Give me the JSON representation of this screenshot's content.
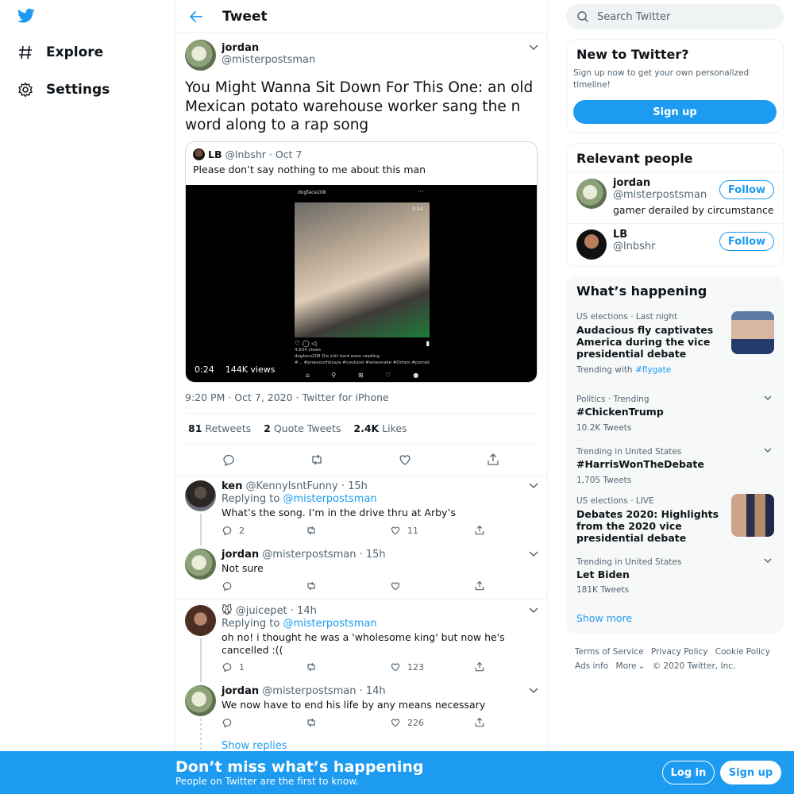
{
  "colors": {
    "accent": "#1d9bf0",
    "text": "#0f1419",
    "muted": "#536471",
    "border": "#eff3f4"
  },
  "nav": {
    "explore": "Explore",
    "settings": "Settings"
  },
  "header": {
    "title": "Tweet"
  },
  "tweet": {
    "name": "jordan",
    "handle": "@misterpostsman",
    "text": "You Might Wanna Sit Down For This One: an old Mexican potato warehouse worker sang the n word along to a rap song",
    "quote": {
      "name": "LB",
      "handle_date": "@lnbshr · Oct 7",
      "text": "Please don’t say nothing to me about this man",
      "video": {
        "account": "dogface208",
        "time_badge": "0:24",
        "views_line": "4,834 views",
        "caption": "dogface208 Dis shit hard even reading",
        "tags": "#... #pnwsouthbraza #couturel #wisesnake #Orfam #pioneba",
        "duration": "0:24",
        "views": "144K views"
      }
    },
    "meta": "9:20 PM · Oct 7, 2020 · Twitter for iPhone",
    "retweets_count": "81",
    "retweets_label": "Retweets",
    "quotes_count": "2",
    "quotes_label": "Quote Tweets",
    "likes_count": "2.4K",
    "likes_label": "Likes"
  },
  "replies": [
    {
      "name": "ken",
      "handle_time": "@KennyIsntFunny · 15h",
      "replying_prefix": "Replying to",
      "replying_to": "@misterpostsman",
      "text": "What’s the song. I’m in the drive thru at Arby’s",
      "replies": "2",
      "likes": "11"
    },
    {
      "name": "jordan",
      "handle_time": "@misterpostsman · 15h",
      "text": "Not sure"
    },
    {
      "name": "🐭",
      "handle_time": "@juicepet · 14h",
      "replying_prefix": "Replying to",
      "replying_to": "@misterpostsman",
      "text": "oh no! i thought he was a 'wholesome king' but now he's cancelled :((",
      "replies": "1",
      "likes": "123"
    },
    {
      "name": "jordan",
      "handle_time": "@misterpostsman · 14h",
      "text": "We now have to end his life by any means necessary",
      "likes": "226"
    }
  ],
  "show_replies": "Show replies",
  "search": {
    "placeholder": "Search Twitter"
  },
  "new_to_twitter": {
    "title": "New to Twitter?",
    "text": "Sign up now to get your own personalized timeline!",
    "button": "Sign up"
  },
  "relevant": {
    "title": "Relevant people",
    "people": [
      {
        "name": "jordan",
        "handle": "@misterpostsman",
        "bio": "gamer derailed by circumstance",
        "follow": "Follow"
      },
      {
        "name": "LB",
        "handle": "@lnbshr",
        "follow": "Follow"
      }
    ]
  },
  "happening": {
    "title": "What’s happening",
    "trends": [
      {
        "meta": "US elections · Last night",
        "title": "Audacious fly captivates America during the vice presidential debate",
        "sub_prefix": "Trending with",
        "sub_link": "#flygate"
      },
      {
        "meta": "Politics · Trending",
        "title": "#ChickenTrump",
        "sub": "10.2K Tweets"
      },
      {
        "meta": "Trending in United States",
        "title": "#HarrisWonTheDebate",
        "sub": "1,705 Tweets"
      },
      {
        "meta": "US elections · LIVE",
        "title": "Debates 2020: Highlights from the 2020 vice presidential debate"
      },
      {
        "meta": "Trending in United States",
        "title": "Let Biden",
        "sub": "181K Tweets"
      }
    ],
    "show_more": "Show more"
  },
  "footer": {
    "terms": "Terms of Service",
    "privacy": "Privacy Policy",
    "cookie": "Cookie Policy",
    "ads": "Ads info",
    "more": "More",
    "copyright": "© 2020 Twitter, Inc."
  },
  "bottom_bar": {
    "title": "Don’t miss what’s happening",
    "subtitle": "People on Twitter are the first to know.",
    "login": "Log in",
    "signup": "Sign up"
  }
}
